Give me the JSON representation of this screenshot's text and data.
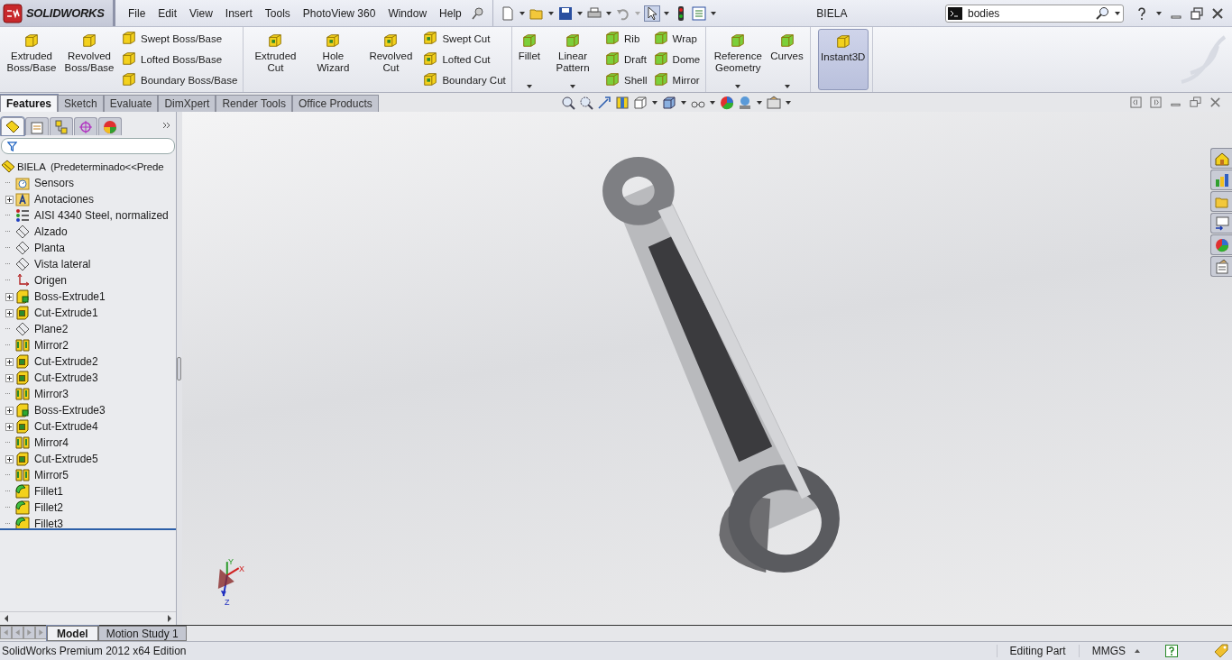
{
  "app": {
    "logo": "SOLIDWORKS",
    "menu": [
      "File",
      "Edit",
      "View",
      "Insert",
      "Tools",
      "PhotoView 360",
      "Window",
      "Help"
    ],
    "title": "BIELA",
    "search": {
      "value": "bodies"
    }
  },
  "ribbon": {
    "groups": [
      {
        "items": [
          {
            "kind": "large",
            "label": "Extruded Boss/Base",
            "dropdown": false,
            "on": false
          },
          {
            "kind": "large",
            "label": "Revolved Boss/Base",
            "dropdown": false,
            "on": false
          },
          {
            "kind": "stack",
            "items": [
              {
                "label": "Swept Boss/Base"
              },
              {
                "label": "Lofted Boss/Base"
              },
              {
                "label": "Boundary Boss/Base"
              }
            ]
          }
        ]
      },
      {
        "items": [
          {
            "kind": "large",
            "label": "Extruded Cut",
            "dropdown": false,
            "on": false
          },
          {
            "kind": "large",
            "label": "Hole Wizard",
            "dropdown": false,
            "on": false
          },
          {
            "kind": "large",
            "label": "Revolved Cut",
            "dropdown": false,
            "on": false
          },
          {
            "kind": "stack",
            "items": [
              {
                "label": "Swept Cut"
              },
              {
                "label": "Lofted Cut"
              },
              {
                "label": "Boundary Cut"
              }
            ]
          }
        ]
      },
      {
        "items": [
          {
            "kind": "large",
            "label": "Fillet",
            "dropdown": true,
            "on": false
          },
          {
            "kind": "large",
            "label": "Linear Pattern",
            "dropdown": true,
            "on": false
          },
          {
            "kind": "stack",
            "items": [
              {
                "label": "Rib"
              },
              {
                "label": "Draft"
              },
              {
                "label": "Shell"
              }
            ]
          },
          {
            "kind": "stack",
            "items": [
              {
                "label": "Wrap"
              },
              {
                "label": "Dome"
              },
              {
                "label": "Mirror"
              }
            ]
          }
        ]
      },
      {
        "items": [
          {
            "kind": "large",
            "label": "Reference Geometry",
            "dropdown": true,
            "on": false
          },
          {
            "kind": "large",
            "label": "Curves",
            "dropdown": true,
            "on": false
          }
        ]
      },
      {
        "items": [
          {
            "kind": "large",
            "label": "Instant3D",
            "dropdown": false,
            "on": true
          }
        ]
      }
    ]
  },
  "command_tabs": [
    {
      "label": "Features",
      "selected": true
    },
    {
      "label": "Sketch",
      "selected": false
    },
    {
      "label": "Evaluate",
      "selected": false
    },
    {
      "label": "DimXpert",
      "selected": false
    },
    {
      "label": "Render Tools",
      "selected": false
    },
    {
      "label": "Office Products",
      "selected": false
    }
  ],
  "panel_tabs": [
    {
      "selected": true
    },
    {
      "selected": false
    },
    {
      "selected": false
    },
    {
      "selected": false
    },
    {
      "selected": false
    }
  ],
  "feature_tree": {
    "root": {
      "label": "BIELA  (Predeterminado<<Prede",
      "children": [
        {
          "label": "Sensors",
          "kind": "sensors",
          "expandable": false
        },
        {
          "label": "Anotaciones",
          "kind": "annotations",
          "expandable": true
        },
        {
          "label": "AISI 4340 Steel, normalized",
          "kind": "material",
          "expandable": false
        },
        {
          "label": "Alzado",
          "kind": "plane",
          "expandable": false
        },
        {
          "label": "Planta",
          "kind": "plane",
          "expandable": false
        },
        {
          "label": "Vista lateral",
          "kind": "plane",
          "expandable": false
        },
        {
          "label": "Origen",
          "kind": "origin",
          "expandable": false
        },
        {
          "label": "Boss-Extrude1",
          "kind": "boss",
          "expandable": true
        },
        {
          "label": "Cut-Extrude1",
          "kind": "cut",
          "expandable": true
        },
        {
          "label": "Plane2",
          "kind": "plane",
          "expandable": false
        },
        {
          "label": "Mirror2",
          "kind": "mirror",
          "expandable": false
        },
        {
          "label": "Cut-Extrude2",
          "kind": "cut",
          "expandable": true
        },
        {
          "label": "Cut-Extrude3",
          "kind": "cut",
          "expandable": true
        },
        {
          "label": "Mirror3",
          "kind": "mirror",
          "expandable": false
        },
        {
          "label": "Boss-Extrude3",
          "kind": "boss",
          "expandable": true
        },
        {
          "label": "Cut-Extrude4",
          "kind": "cut",
          "expandable": true
        },
        {
          "label": "Mirror4",
          "kind": "mirror",
          "expandable": false
        },
        {
          "label": "Cut-Extrude5",
          "kind": "cut",
          "expandable": true
        },
        {
          "label": "Mirror5",
          "kind": "mirror",
          "expandable": false
        },
        {
          "label": "Fillet1",
          "kind": "fillet",
          "expandable": false
        },
        {
          "label": "Fillet2",
          "kind": "fillet",
          "expandable": false
        },
        {
          "label": "Fillet3",
          "kind": "fillet",
          "expandable": false
        }
      ]
    }
  },
  "triad": {
    "y": "Y",
    "x": "X",
    "z": "Z"
  },
  "model_tabs": [
    {
      "label": "Model",
      "selected": true
    },
    {
      "label": "Motion Study 1",
      "selected": false
    }
  ],
  "status_bar": {
    "text": "SolidWorks Premium 2012 x64 Edition",
    "mode": "Editing Part",
    "units": "MMGS"
  }
}
